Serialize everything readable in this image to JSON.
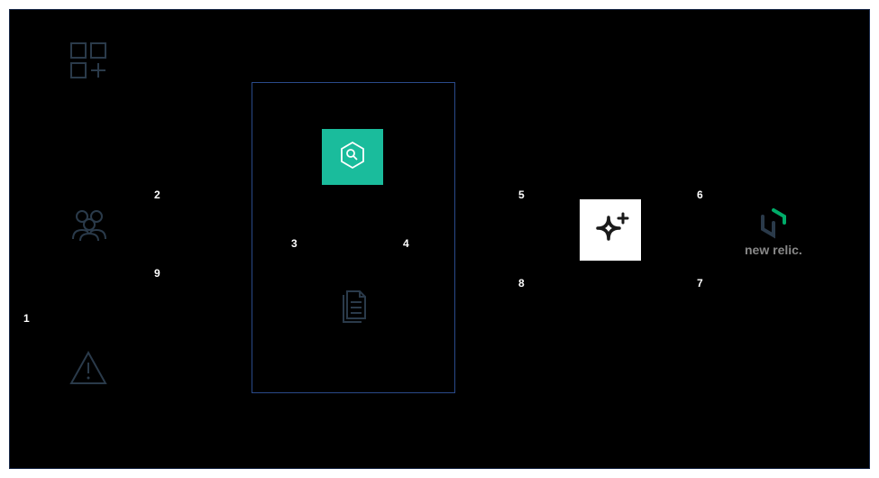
{
  "labels": {
    "n1": "1",
    "n2": "2",
    "n3": "3",
    "n4": "4",
    "n5": "5",
    "n6": "6",
    "n7": "7",
    "n8": "8",
    "n9": "9"
  },
  "icons": {
    "grid_plus": "grid-plus",
    "users": "users",
    "warning": "warning",
    "hexagon_search": "hexagon-search",
    "documents": "documents",
    "sparkle": "sparkle",
    "newrelic": "new-relic-logo"
  },
  "logo_text": "new relic.",
  "colors": {
    "teal": "#1abc9c",
    "border_blue": "#2a4a8a",
    "outline_dark": "#2a3a4a",
    "green": "#00ac69"
  }
}
